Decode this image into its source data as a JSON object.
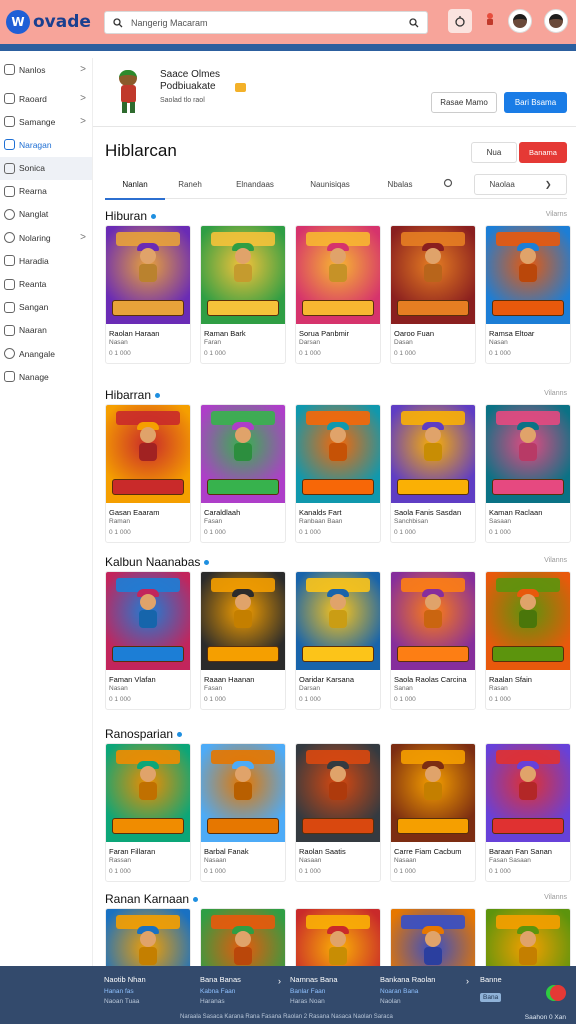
{
  "header": {
    "logo_mark": "W",
    "logo_text": "ovade",
    "search_placeholder": "Nangerig Macaram"
  },
  "sidebar": {
    "items": [
      {
        "label": "Nanlos",
        "icon": "grid-icon",
        "chevron": ">"
      },
      {
        "label": "Raoard",
        "icon": "home-icon",
        "chevron": ">"
      },
      {
        "label": "Samange",
        "icon": "gamepad-icon",
        "chevron": ">"
      },
      {
        "label": "Naragan",
        "icon": "category-icon",
        "chevron": ""
      },
      {
        "label": "Sonica",
        "icon": "star-icon",
        "chevron": ""
      },
      {
        "label": "Rearna",
        "icon": "trophy-icon",
        "chevron": ""
      },
      {
        "label": "Nanglat",
        "icon": "chat-icon",
        "chevron": ""
      },
      {
        "label": "Nolaring",
        "icon": "globe-icon",
        "chevron": ">"
      },
      {
        "label": "Haradia",
        "icon": "bookmark-icon",
        "chevron": ""
      },
      {
        "label": "Reanta",
        "icon": "clock-icon",
        "chevron": ""
      },
      {
        "label": "Sangan",
        "icon": "heart-icon",
        "chevron": ""
      },
      {
        "label": "Naaran",
        "icon": "gift-icon",
        "chevron": ""
      },
      {
        "label": "Anangale",
        "icon": "info-icon",
        "chevron": ""
      },
      {
        "label": "Nanage",
        "icon": "settings-icon",
        "chevron": ""
      }
    ]
  },
  "profile": {
    "title": "Saace Olmes\nPodbiuakate",
    "subtitle": "Saolad tlo raol",
    "button_outline": "Rasae Mamo",
    "button_primary": "Bari Bsama"
  },
  "page": {
    "title": "Hiblarcan",
    "btn_ghost": "Nua",
    "btn_red": "Banama"
  },
  "tabs": {
    "items": [
      "Nanlan",
      "Raneh",
      "Elnandaas",
      "Naunisiqas",
      "Nbalas"
    ],
    "select": "Naolaa",
    "select_chevron": "❯"
  },
  "sections": [
    {
      "title": "Hiburan",
      "more": "Vilarns",
      "cards": [
        {
          "title": "Raolan Haraan",
          "sub": "Nasan",
          "meta": "0 1 000"
        },
        {
          "title": "Raman Bark",
          "sub": "Faran",
          "meta": "0 1 000"
        },
        {
          "title": "Sorua Panbmir",
          "sub": "Darsan",
          "meta": "0 1 000"
        },
        {
          "title": "Oaroo Fuan",
          "sub": "Dasan",
          "meta": "0 1 000"
        },
        {
          "title": "Ramsa Eltoar",
          "sub": "Nasan",
          "meta": "0 1 000"
        }
      ]
    },
    {
      "title": "Hibarran",
      "more": "Vilanns",
      "cards": [
        {
          "title": "Gasan Eaaram",
          "sub": "Raman",
          "meta": "0 1 000"
        },
        {
          "title": "Caraldlaah",
          "sub": "Fasan",
          "meta": "0 1 000"
        },
        {
          "title": "Kanalds Fart",
          "sub": "Ranbaan Baan",
          "meta": "0 1 000"
        },
        {
          "title": "Saola Fanis Sasdan",
          "sub": "Sanchbisan",
          "meta": "0 1 000"
        },
        {
          "title": "Kaman Raclaan",
          "sub": "Sasaan",
          "meta": "0 1 000"
        }
      ]
    },
    {
      "title": "Kalbun Naanabas",
      "more": "Vilanns",
      "cards": [
        {
          "title": "Faman Vlafan",
          "sub": "Nasan",
          "meta": "0 1 000"
        },
        {
          "title": "Raaan Haanan",
          "sub": "Fasan",
          "meta": "0 1 000"
        },
        {
          "title": "Oaridar Karsana",
          "sub": "Darsan",
          "meta": "0 1 000"
        },
        {
          "title": "Saola Raolas Carcina",
          "sub": "Sanan",
          "meta": "0 1 000"
        },
        {
          "title": "Raalan Sfain",
          "sub": "Rasan",
          "meta": "0 1 000"
        }
      ]
    },
    {
      "title": "Ranosparian",
      "more": "",
      "cards": [
        {
          "title": "Faran Fillaran",
          "sub": "Rassan",
          "meta": "0 1 000"
        },
        {
          "title": "Barbal Fanak",
          "sub": "Nasaan",
          "meta": "0 1 000"
        },
        {
          "title": "Raolan Saatis",
          "sub": "Nasaan",
          "meta": "0 1 000"
        },
        {
          "title": "Carre Fiam Cacbum",
          "sub": "Nasaan",
          "meta": "0 1 000"
        },
        {
          "title": "Baraan Fan Sanan",
          "sub": "Fasan Sasaan",
          "meta": "0 1 000"
        }
      ]
    },
    {
      "title": "Ranan Karnaan",
      "more": "Vilanns",
      "cards": [
        {
          "title": "",
          "sub": "",
          "meta": ""
        },
        {
          "title": "",
          "sub": "",
          "meta": ""
        },
        {
          "title": "",
          "sub": "",
          "meta": ""
        },
        {
          "title": "",
          "sub": "",
          "meta": ""
        },
        {
          "title": "",
          "sub": "",
          "meta": ""
        }
      ]
    }
  ],
  "footer": {
    "col1": {
      "title": "Naotib Nhan",
      "l2": "Hanan fas",
      "l3": "Naoan Tuaa"
    },
    "col2": {
      "title": "Bana Banas",
      "l2": "Kabna Faan",
      "l3": "Haranas"
    },
    "col3": {
      "title": "Namnas Bana",
      "l2": "Banlar Faan",
      "l3": "Haras Noan"
    },
    "col4": {
      "title": "Bankana Raolan",
      "l2": "Noaran Bana",
      "l3": "Naolan"
    },
    "col5": {
      "title": "Banne",
      "badge": "Bana"
    },
    "copyright": "Naraala Sasaca Karana Rana Fasana Raolan 2 Rasana Nasaca Naolan Saraca",
    "right": "Saahon 0 Xan"
  }
}
